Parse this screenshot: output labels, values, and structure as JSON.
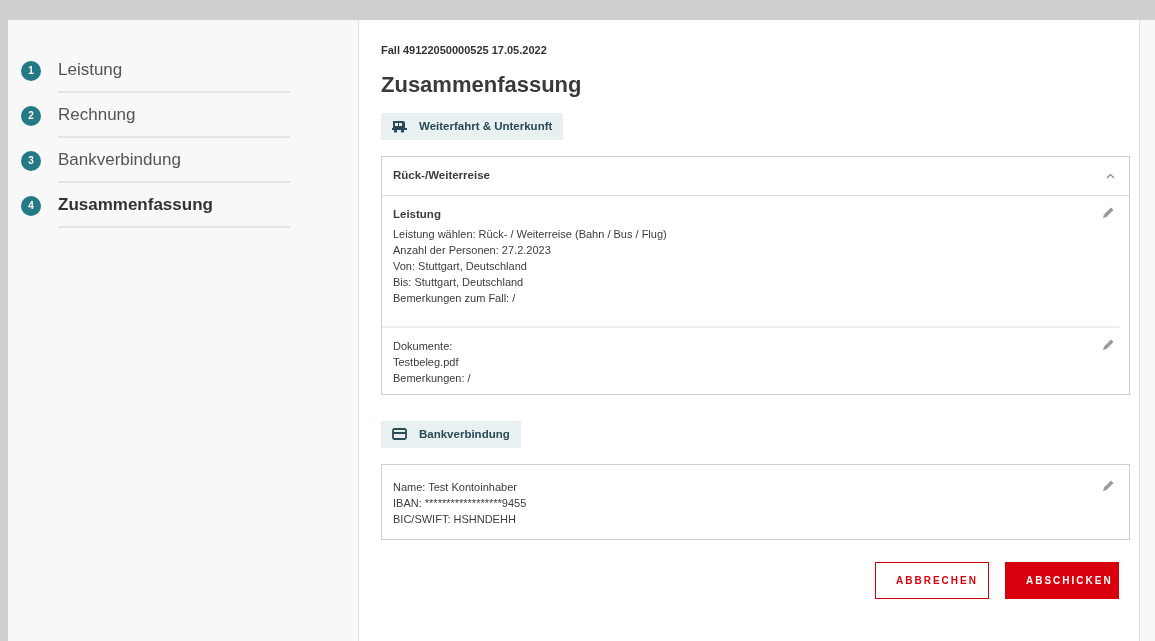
{
  "steps": [
    {
      "number": "1",
      "label": "Leistung",
      "selected": false
    },
    {
      "number": "2",
      "label": "Rechnung",
      "selected": false
    },
    {
      "number": "3",
      "label": "Bankverbindung",
      "selected": false
    },
    {
      "number": "4",
      "label": "Zusammenfassung",
      "selected": true
    }
  ],
  "case_line": "Fall 49122050000525 17.05.2022",
  "title": "Zusammenfassung",
  "sections": [
    {
      "kind": "travel",
      "tag": "Weiterfahrt & Unterkunft",
      "panel": {
        "title": "Rück-/Weiterreise",
        "expanded": true,
        "blocks": [
          {
            "heading": "Leistung",
            "lines": [
              "Leistung wählen: Rück- / Weiterreise (Bahn / Bus / Flug)",
              "Anzahl der Personen: 27.2.2023",
              "Von: Stuttgart, Deutschland",
              "Bis: Stuttgart, Deutschland",
              "Bemerkungen zum Fall: /"
            ]
          },
          {
            "lines": [
              "Dokumente:",
              "Testbeleg.pdf",
              "Bemerkungen: /"
            ]
          }
        ]
      }
    },
    {
      "kind": "bank",
      "tag": "Bankverbindung",
      "panel": {
        "blocks": [
          {
            "lines": [
              "Name: Test Kontoinhaber",
              "IBAN: ******************9455",
              "BIC/SWIFT: HSHNDEHH"
            ]
          }
        ]
      }
    }
  ],
  "buttons": [
    {
      "label": "ABBRECHEN",
      "kind": "outline"
    },
    {
      "label": "ABSCHICKEN",
      "kind": "primary"
    }
  ]
}
